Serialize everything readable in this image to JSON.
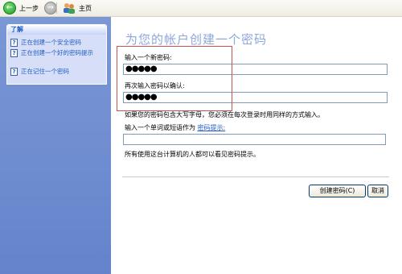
{
  "toolbar": {
    "back_label": "上一步",
    "home_label": "主页",
    "icons": {
      "back": "back-arrow-icon",
      "forward": "forward-arrow-icon",
      "home": "users-home-icon"
    }
  },
  "learn_panel": {
    "title": "了解",
    "items": [
      {
        "label": "正在创建一个安全密码"
      },
      {
        "label": "正在创建一个好的密码提示"
      },
      {
        "label": "正在记住一个密码"
      }
    ]
  },
  "main": {
    "title": "为您的帐户创建一个密码",
    "new_password_label": "输入一个新密码:",
    "new_password_value": "●●●●●",
    "confirm_label": "再次输入密码以确认:",
    "confirm_value": "●●●●●",
    "caps_note": "如果您的密码包含大写字母，您必须在每次登录时用同样的方式输入。",
    "hint_label": "输入一个单词或短语作为",
    "hint_link": "密码提示:",
    "hint_value": "",
    "visibility_note": "所有使用这台计算机的人都可以看见密码提示。",
    "create_button": "创建密码(C)",
    "cancel_button": "取消"
  }
}
